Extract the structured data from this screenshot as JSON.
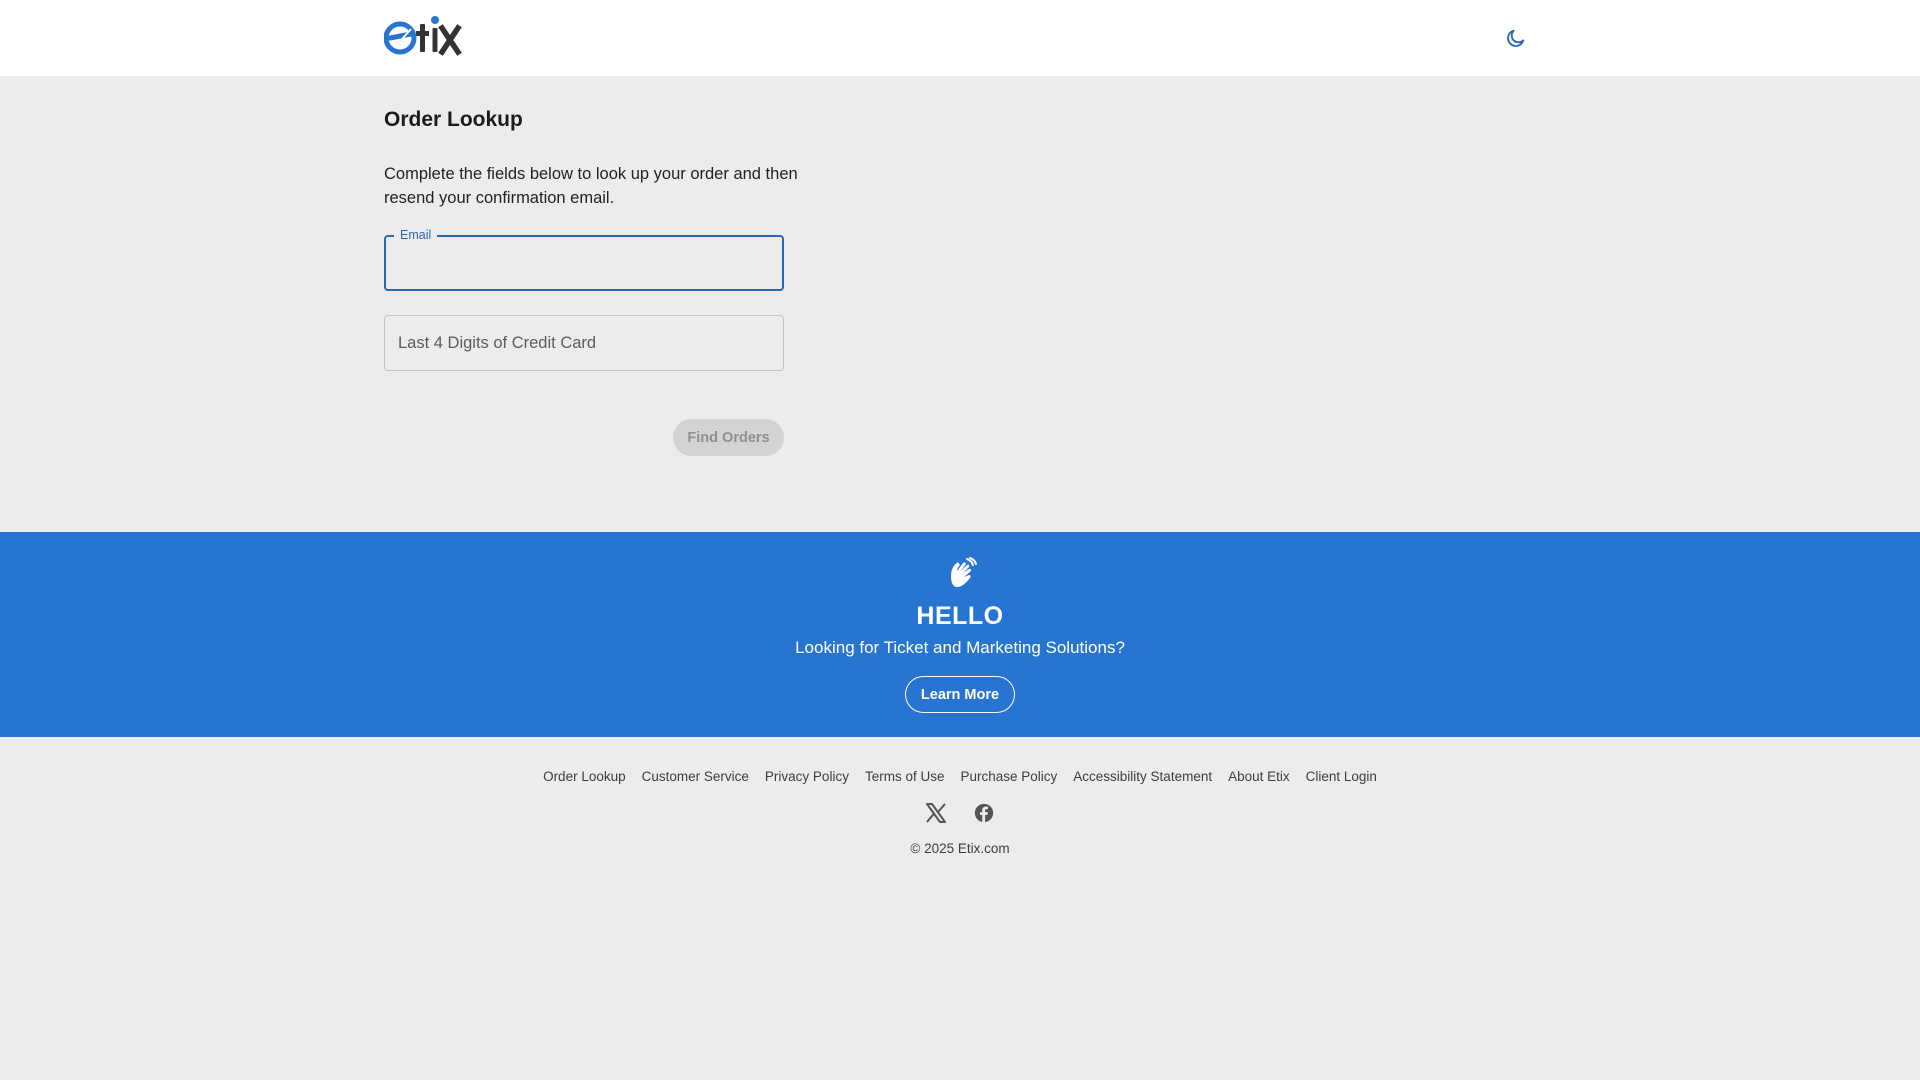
{
  "header": {
    "logo_text": "etix",
    "theme_toggle_icon": "moon-icon"
  },
  "colors": {
    "brand_blue": "#2775d1",
    "focus_blue": "#2a67b5",
    "page_bg": "#ececee"
  },
  "main": {
    "title": "Order Lookup",
    "intro": "Complete the fields below to look up your order and then resend your confirmation email.",
    "email": {
      "label": "Email",
      "value": ""
    },
    "card": {
      "placeholder": "Last 4 Digits of Credit Card",
      "value": ""
    },
    "find_button": "Find Orders"
  },
  "banner": {
    "icon": "waving-hands-icon",
    "title": "HELLO",
    "subtitle": "Looking for Ticket and Marketing Solutions?",
    "button": "Learn More"
  },
  "footer": {
    "links": [
      "Order Lookup",
      "Customer Service",
      "Privacy Policy",
      "Terms of Use",
      "Purchase Policy",
      "Accessibility Statement",
      "About Etix",
      "Client Login"
    ],
    "social_icons": [
      "x-icon",
      "facebook-icon"
    ],
    "copyright": "© 2025 Etix.com"
  }
}
